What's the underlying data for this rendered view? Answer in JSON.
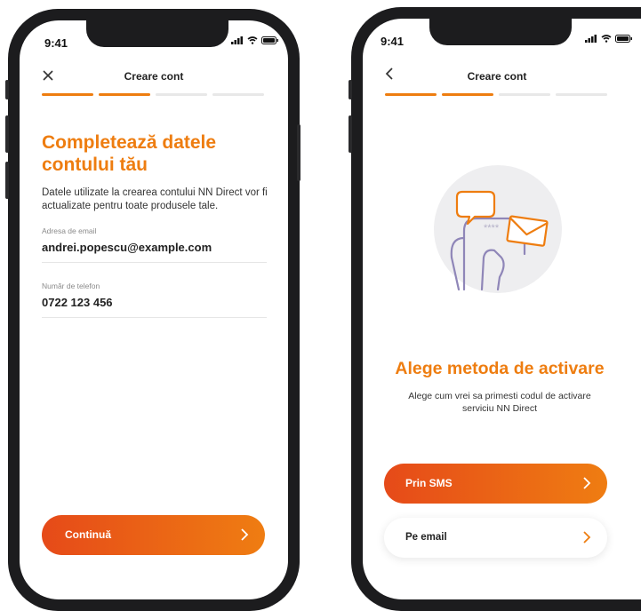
{
  "colors": {
    "accent": "#ee7d10",
    "accent_dark": "#e64a19",
    "step_active": "#ee7d10",
    "step_inactive": "#e8e8e8"
  },
  "screen1": {
    "time": "9:41",
    "nav_title": "Creare cont",
    "close_icon": "close-icon",
    "headline_line1": "Completează datele",
    "headline_line2": "contului tău",
    "description_line1": "Datele utilizate la crearea contului NN Direct vor fi",
    "description_line2": "actualizate pentru toate produsele tale.",
    "email_label": "Adresa de email",
    "email_value": "andrei.popescu@example.com",
    "phone_label": "Număr de telefon",
    "phone_value": "0722 123 456",
    "continue_label": "Continuă"
  },
  "screen2": {
    "time": "9:41",
    "nav_title": "Creare cont",
    "back_icon": "chevron-left-icon",
    "illustration_pin": "****",
    "headline": "Alege metoda de activare",
    "description_line1": "Alege cum vrei sa primesti codul de activare",
    "description_line2": "serviciu NN Direct",
    "sms_label": "Prin SMS",
    "email_label": "Pe email"
  }
}
